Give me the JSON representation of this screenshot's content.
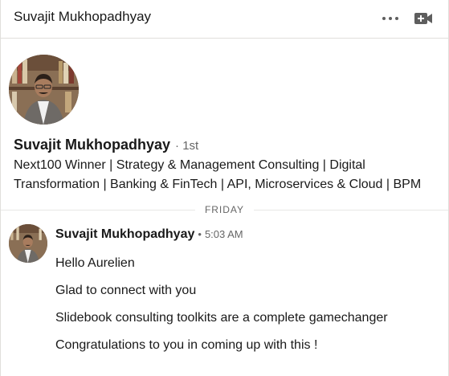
{
  "header": {
    "title": "Suvajit Mukhopadhyay",
    "more_icon": "more-horizontal-icon",
    "compose_icon": "video-add-icon"
  },
  "profile": {
    "name": "Suvajit Mukhopadhyay",
    "degree": "· 1st",
    "headline": "Next100 Winner | Strategy & Management Consulting | Digital Transformation | Banking & FinTech | API, Microservices & Cloud | BPM"
  },
  "divider": {
    "label": "FRIDAY"
  },
  "message": {
    "sender": "Suvajit Mukhopadhyay",
    "dot": "•",
    "time": "5:03 AM",
    "lines": [
      "Hello Aurelien",
      "Glad to connect with you",
      "Slidebook consulting toolkits are a complete gamechanger",
      "Congratulations to you in coming up with this !"
    ]
  },
  "colors": {
    "text": "#191919",
    "muted": "#666666",
    "border": "#e0dfdc"
  }
}
